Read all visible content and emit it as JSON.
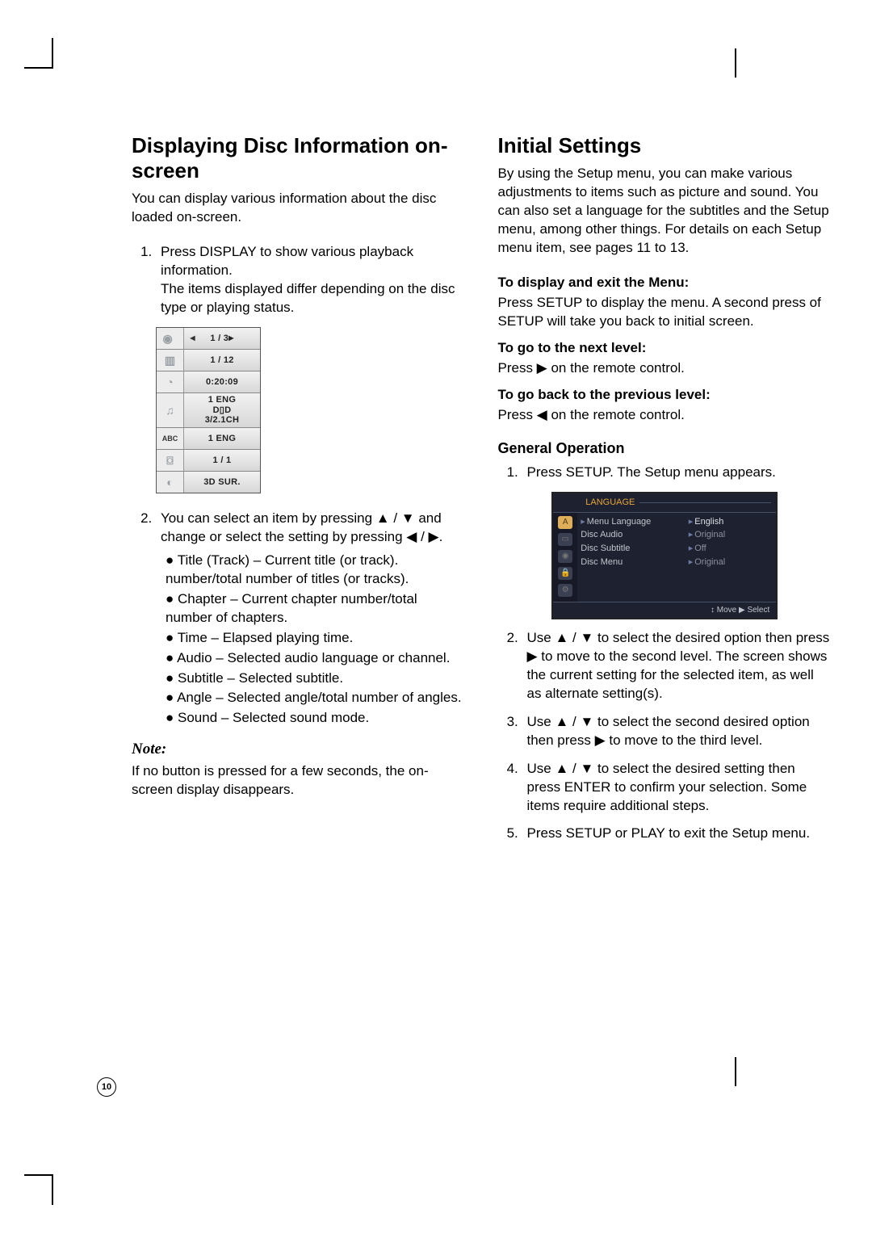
{
  "page_number": "10",
  "left": {
    "heading": "Displaying Disc Information on-screen",
    "intro": "You can display various information about the disc loaded on-screen.",
    "step1_a": "Press DISPLAY to show various playback information.",
    "step1_b": "The items displayed differ depending on the disc type or playing status.",
    "osd": {
      "title": "1 / 3",
      "chapter": "1 / 12",
      "time": "0:20:09",
      "audio1": "1 ENG",
      "audio2": "D▯D",
      "audio3": "3/2.1CH",
      "subtitle": "1 ENG",
      "angle": "1 / 1",
      "sound": "3D SUR."
    },
    "step2_lead": "You can select an item by pressing ▲ / ▼ and change or select the setting by pressing ◀ / ▶.",
    "bullets": [
      "Title (Track) – Current title (or track). number/total number of titles (or tracks).",
      "Chapter – Current chapter number/total number of chapters.",
      "Time – Elapsed playing time.",
      "Audio – Selected audio language or channel.",
      "Subtitle – Selected subtitle.",
      "Angle – Selected angle/total number of angles.",
      "Sound – Selected sound mode."
    ],
    "note_head": "Note:",
    "note_body": "If no button is pressed for a few seconds, the on-screen display disappears."
  },
  "right": {
    "heading": "Initial Settings",
    "intro": "By using the Setup menu, you can make various adjustments to items such as picture and sound. You can also set a language for the subtitles and the Setup menu, among other things. For details on each Setup menu item, see pages 11 to 13.",
    "sub1_head": "To display and exit the Menu:",
    "sub1_body": "Press SETUP to display the menu. A second press of SETUP will take you back to initial screen.",
    "sub2_head": "To go to the next level:",
    "sub2_body": "Press ▶ on the remote control.",
    "sub3_head": "To go back to the previous level:",
    "sub3_body": "Press ◀ on the remote control.",
    "genop_head": "General Operation",
    "steps": {
      "s1": "Press SETUP. The Setup menu appears.",
      "s2": "Use ▲ / ▼ to select the desired option then press ▶ to move to the second level. The screen shows the current setting for the selected item, as well as alternate setting(s).",
      "s3": "Use ▲ / ▼ to select the second desired option then press ▶ to move to the third level.",
      "s4": "Use ▲ / ▼ to select the desired setting then press ENTER to confirm your selection. Some items require additional steps.",
      "s5": "Press SETUP or PLAY to exit the Setup menu."
    },
    "setup_menu": {
      "title": "LANGUAGE",
      "items": [
        "Menu Language",
        "Disc Audio",
        "Disc Subtitle",
        "Disc Menu"
      ],
      "values": [
        "English",
        "Original",
        "Off",
        "Original"
      ],
      "footer": "↕ Move ▶ Select"
    }
  }
}
